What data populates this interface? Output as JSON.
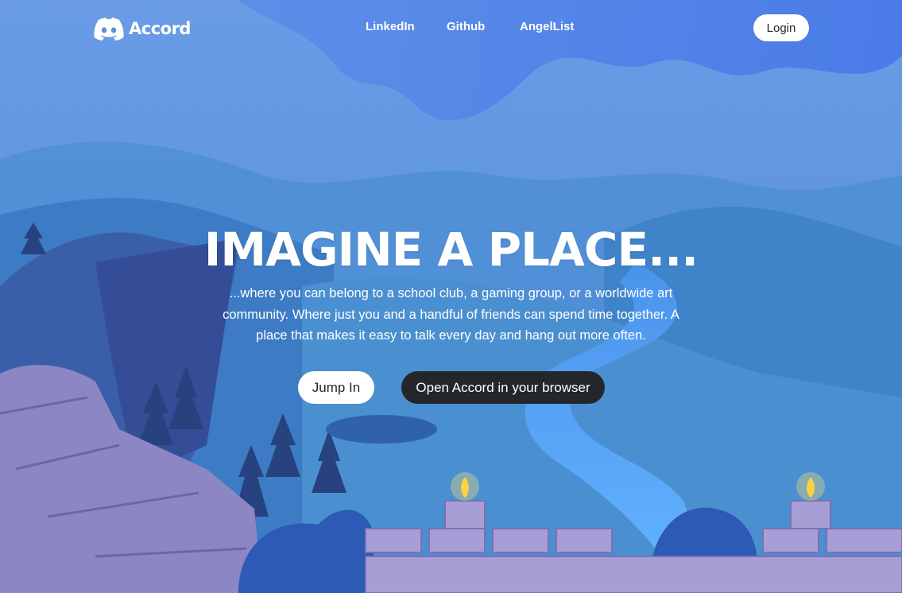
{
  "brand": {
    "name": "Accord",
    "icon": "discord-logo-icon"
  },
  "nav": {
    "links": [
      "LinkedIn",
      "Github",
      "AngelList"
    ],
    "login_label": "Login"
  },
  "hero": {
    "title": "IMAGINE A PLACE...",
    "body": "...where you can belong to a school club, a gaming group, or a worldwide art community. Where just you and a handful of friends can spend time together. A place that makes it easy to talk every day and hang out more often.",
    "primary_button": "Jump In",
    "secondary_button": "Open Accord in your browser"
  },
  "colors": {
    "sky": "#5b8fe0",
    "cloud": "#4a7be6",
    "hills": "#3f7fc8",
    "river": "#5aa8ff",
    "rock": "#8d86c4",
    "button_dark": "#23272a",
    "text": "#ffffff"
  }
}
